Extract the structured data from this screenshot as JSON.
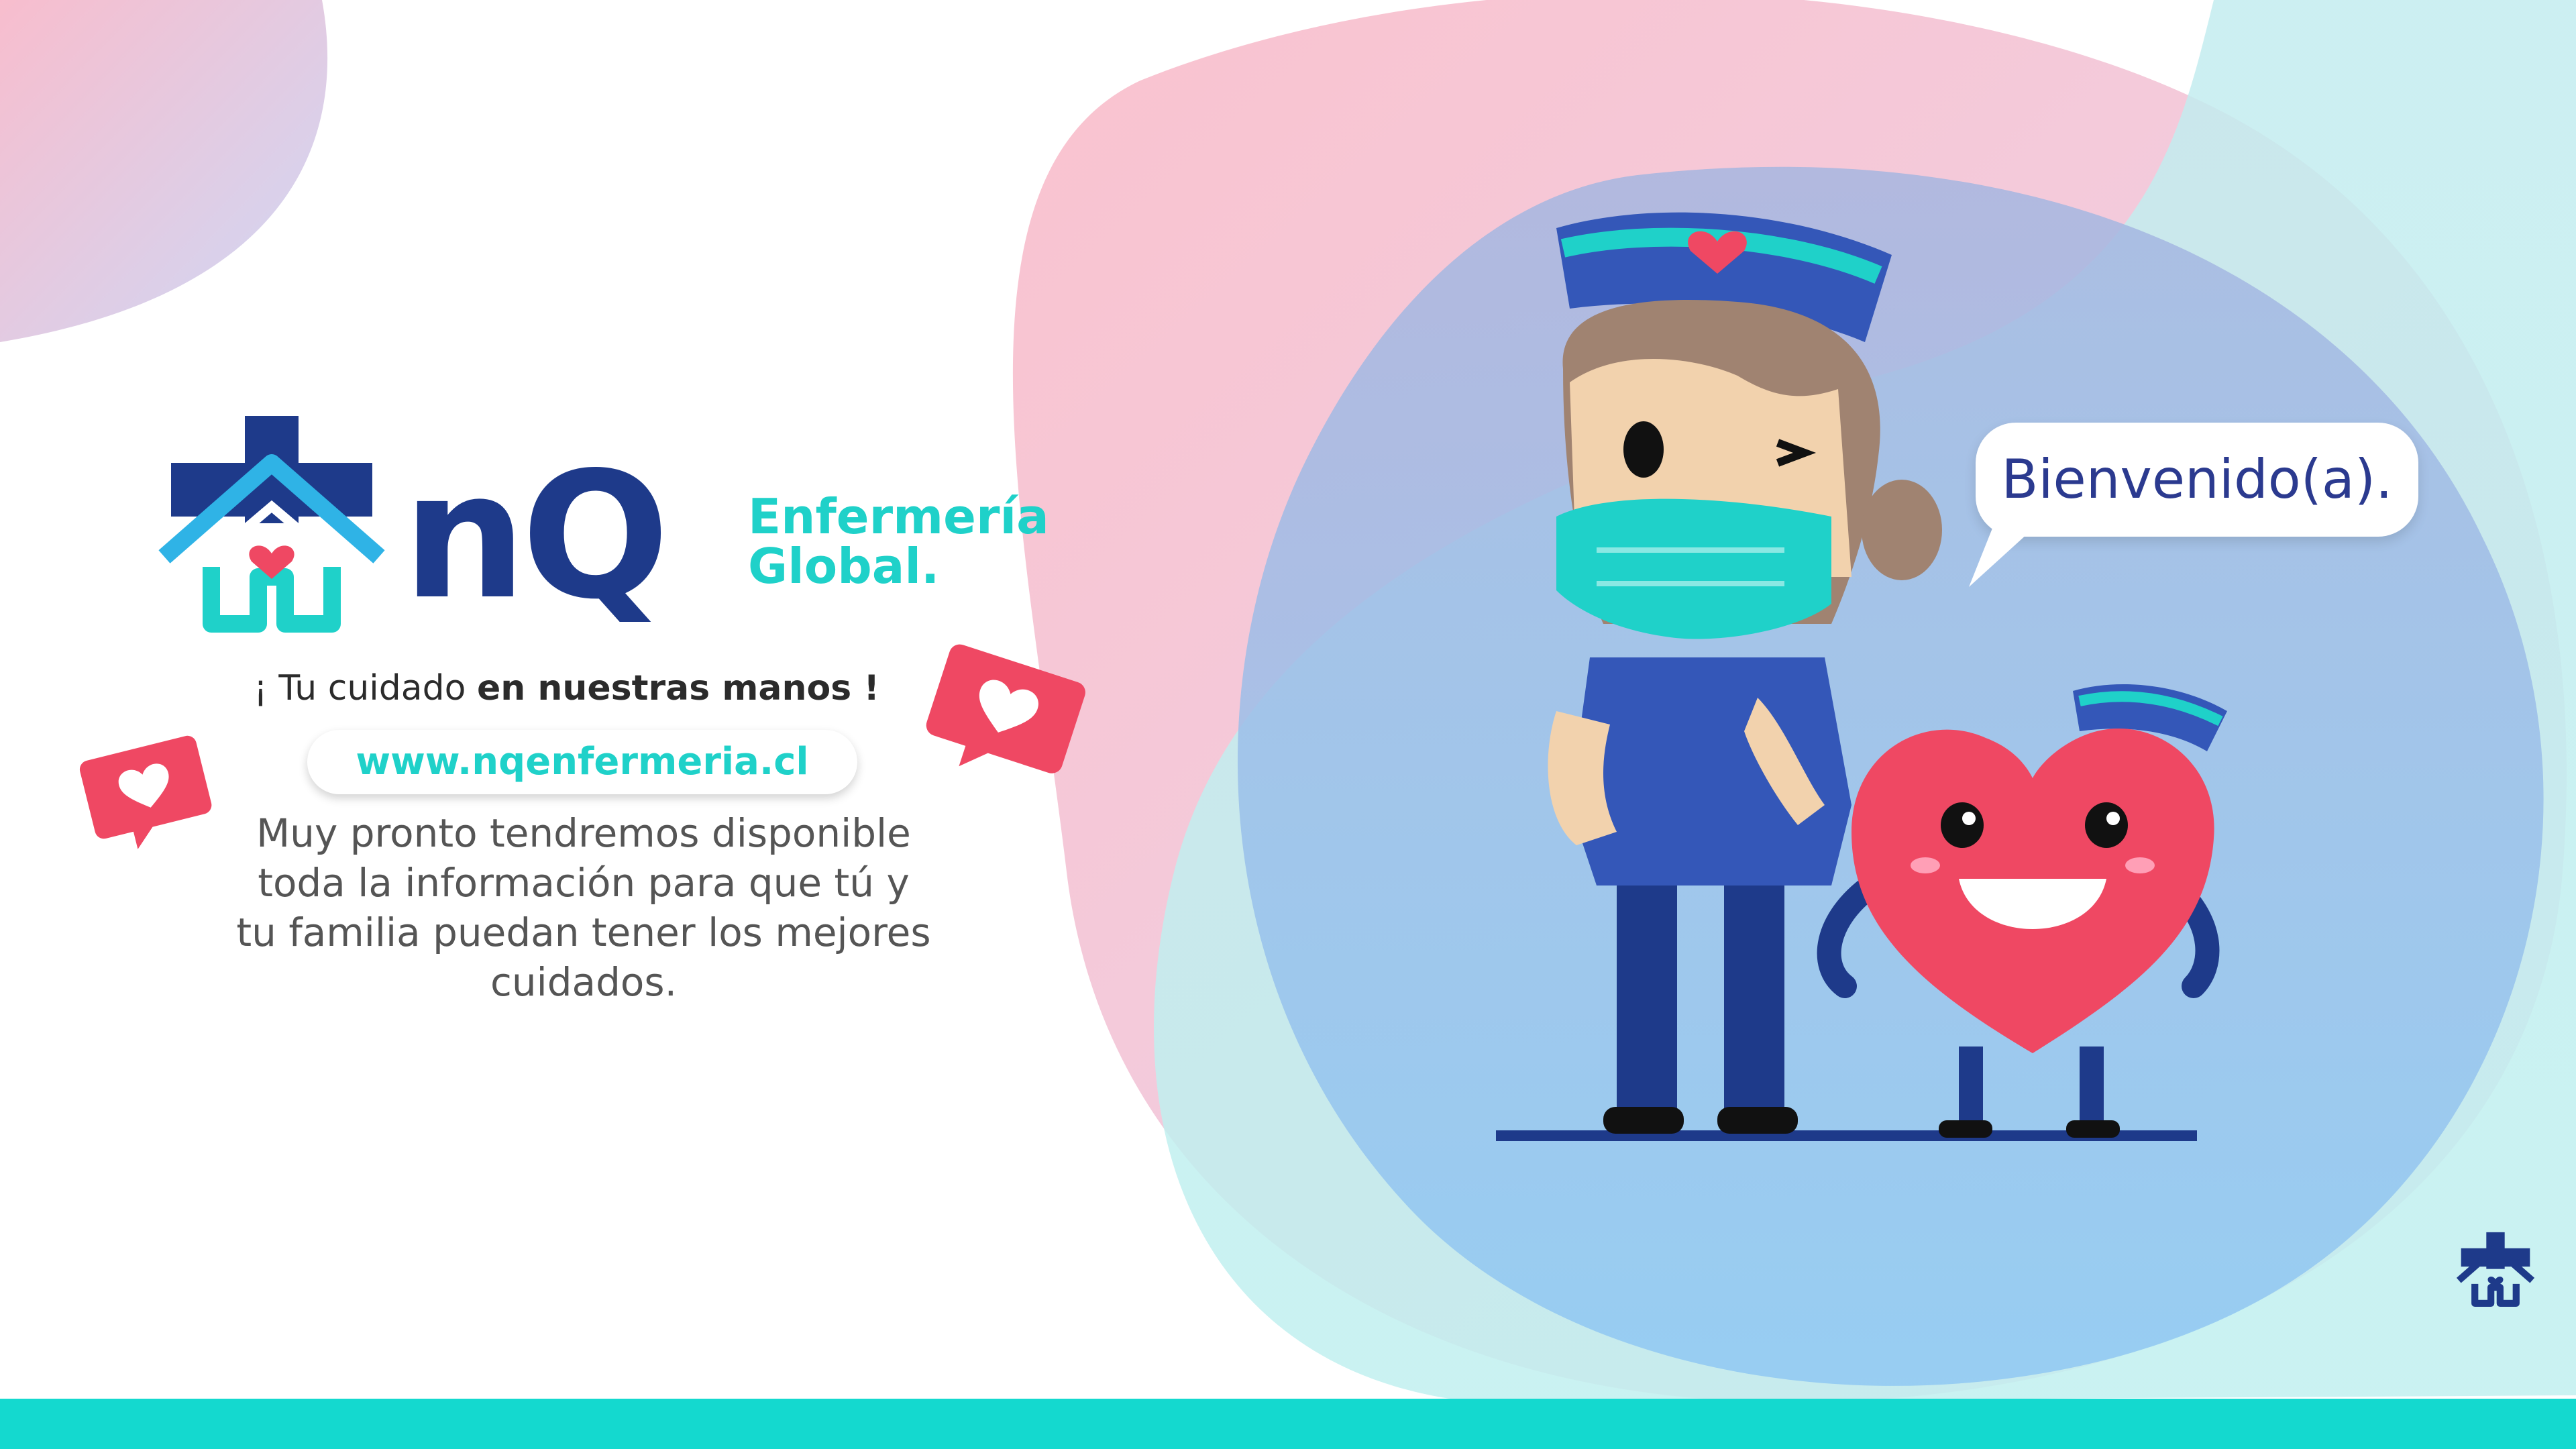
{
  "brand": {
    "mark": "nQ",
    "name_line1": "Enfermería",
    "name_line2": "Global."
  },
  "tagline": {
    "part1": "¡ Tu cuidado",
    "part2": "en nuestras manos !"
  },
  "url": "www.nqenfermeria.cl",
  "description": [
    "Muy pronto tendremos disponible",
    "toda la información para que tú y",
    "tu familia puedan tener los mejores",
    "cuidados."
  ],
  "speech_bubble": "Bienvenido(a).",
  "colors": {
    "brand_navy": "#1e3a8a",
    "brand_teal": "#1fd1c9",
    "heart_red": "#ef4863",
    "bottom_bar": "#14d9cf"
  },
  "icons": [
    "house-cross-logo-icon",
    "heart-like-icon",
    "nurse-illustration",
    "heart-character-illustration"
  ]
}
